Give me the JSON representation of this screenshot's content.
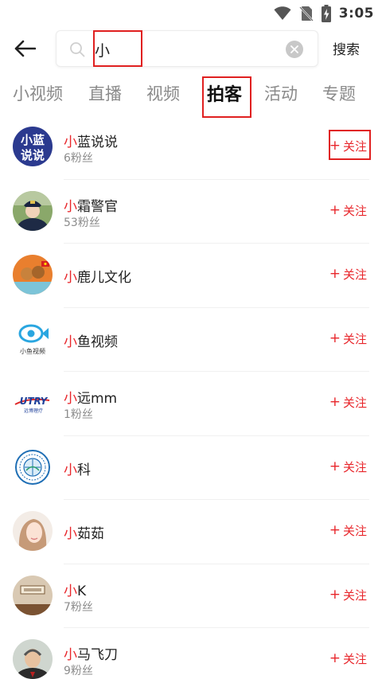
{
  "status_bar": {
    "time": "3:05"
  },
  "search": {
    "query": "小",
    "submit_label": "搜索"
  },
  "tabs": [
    {
      "label": "小视频",
      "active": false
    },
    {
      "label": "直播",
      "active": false
    },
    {
      "label": "视频",
      "active": false
    },
    {
      "label": "拍客",
      "active": true
    },
    {
      "label": "活动",
      "active": false
    },
    {
      "label": "专题",
      "active": false
    }
  ],
  "results": [
    {
      "name_hl": "小",
      "name_rest": "蓝说说",
      "fans": "6粉丝",
      "follow_plus": "+",
      "follow_label": "关注",
      "avatar_text_1": "小蓝",
      "avatar_text_2": "说说"
    },
    {
      "name_hl": "小",
      "name_rest": "霜警官",
      "fans": "53粉丝",
      "follow_plus": "+",
      "follow_label": "关注"
    },
    {
      "name_hl": "小",
      "name_rest": "鹿儿文化",
      "fans": "",
      "follow_plus": "+",
      "follow_label": "关注"
    },
    {
      "name_hl": "小",
      "name_rest": "鱼视频",
      "fans": "",
      "follow_plus": "+",
      "follow_label": "关注",
      "avatar_caption": "小鱼视频"
    },
    {
      "name_hl": "小",
      "name_rest": "远mm",
      "fans": "1粉丝",
      "follow_plus": "+",
      "follow_label": "关注",
      "avatar_logo": "UTRY",
      "avatar_caption": "远博理疗"
    },
    {
      "name_hl": "小",
      "name_rest": "科",
      "fans": "",
      "follow_plus": "+",
      "follow_label": "关注"
    },
    {
      "name_hl": "小",
      "name_rest": "茹茹",
      "fans": "",
      "follow_plus": "+",
      "follow_label": "关注"
    },
    {
      "name_hl": "小",
      "name_rest": "K",
      "fans": "7粉丝",
      "follow_plus": "+",
      "follow_label": "关注"
    },
    {
      "name_hl": "小",
      "name_rest": "马飞刀",
      "fans": "9粉丝",
      "follow_plus": "+",
      "follow_label": "关注"
    }
  ],
  "colors": {
    "accent_red": "#e8262b",
    "highlight_box": "#e02020",
    "muted": "#8c8c8c"
  }
}
